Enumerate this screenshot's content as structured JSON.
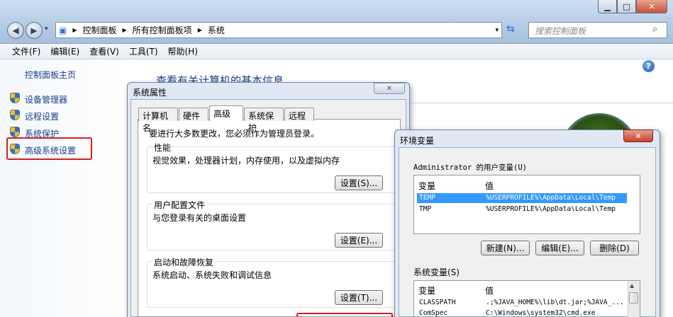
{
  "window": {
    "minimize": "▁",
    "maximize": "□",
    "close": "✕"
  },
  "breadcrumb": [
    "控制面板",
    "所有控制面板项",
    "系统"
  ],
  "search_placeholder": "搜索控制面板",
  "menu": [
    "文件(F)",
    "编辑(E)",
    "查看(V)",
    "工具(T)",
    "帮助(H)"
  ],
  "left_pane": {
    "home": "控制面板主页",
    "links": [
      "设备管理器",
      "远程设置",
      "系统保护",
      "高级系统设置"
    ]
  },
  "main_heading": "查看有关计算机的基本信息",
  "sysprops": {
    "title": "系统属性",
    "tabs": [
      "计算机名",
      "硬件",
      "高级",
      "系统保护",
      "远程"
    ],
    "admin_note": "要进行大多数更改，您必须作为管理员登录。",
    "groups": [
      {
        "title": "性能",
        "desc": "视觉效果，处理器计划，内存使用，以及虚拟内存",
        "button": "设置(S)..."
      },
      {
        "title": "用户配置文件",
        "desc": "与您登录有关的桌面设置",
        "button": "设置(E)..."
      },
      {
        "title": "启动和故障恢复",
        "desc": "系统启动、系统失败和调试信息",
        "button": "设置(T)..."
      }
    ]
  },
  "envvars": {
    "title": "环境变量",
    "close": "✕",
    "user_label": "Administrator 的用户变量(U)",
    "col_var": "变量",
    "col_val": "值",
    "user_vars": [
      {
        "name": "TEMP",
        "value": "%USERPROFILE%\\AppData\\Local\\Temp"
      },
      {
        "name": "TMP",
        "value": "%USERPROFILE%\\AppData\\Local\\Temp"
      }
    ],
    "btn_new": "新建(N)...",
    "btn_edit": "编辑(E)...",
    "btn_delete": "删除(D)",
    "sys_label": "系统变量(S)",
    "sys_vars": [
      {
        "name": "CLASSPATH",
        "value": ".;%JAVA_HOME%\\lib\\dt.jar;%JAVA_..."
      },
      {
        "name": "ComSpec",
        "value": "C:\\Windows\\system32\\cmd.exe"
      }
    ]
  },
  "colors": {
    "accent": "#1a3e8a",
    "highlight_red": "#d81e1e",
    "selection": "#3399ff"
  }
}
